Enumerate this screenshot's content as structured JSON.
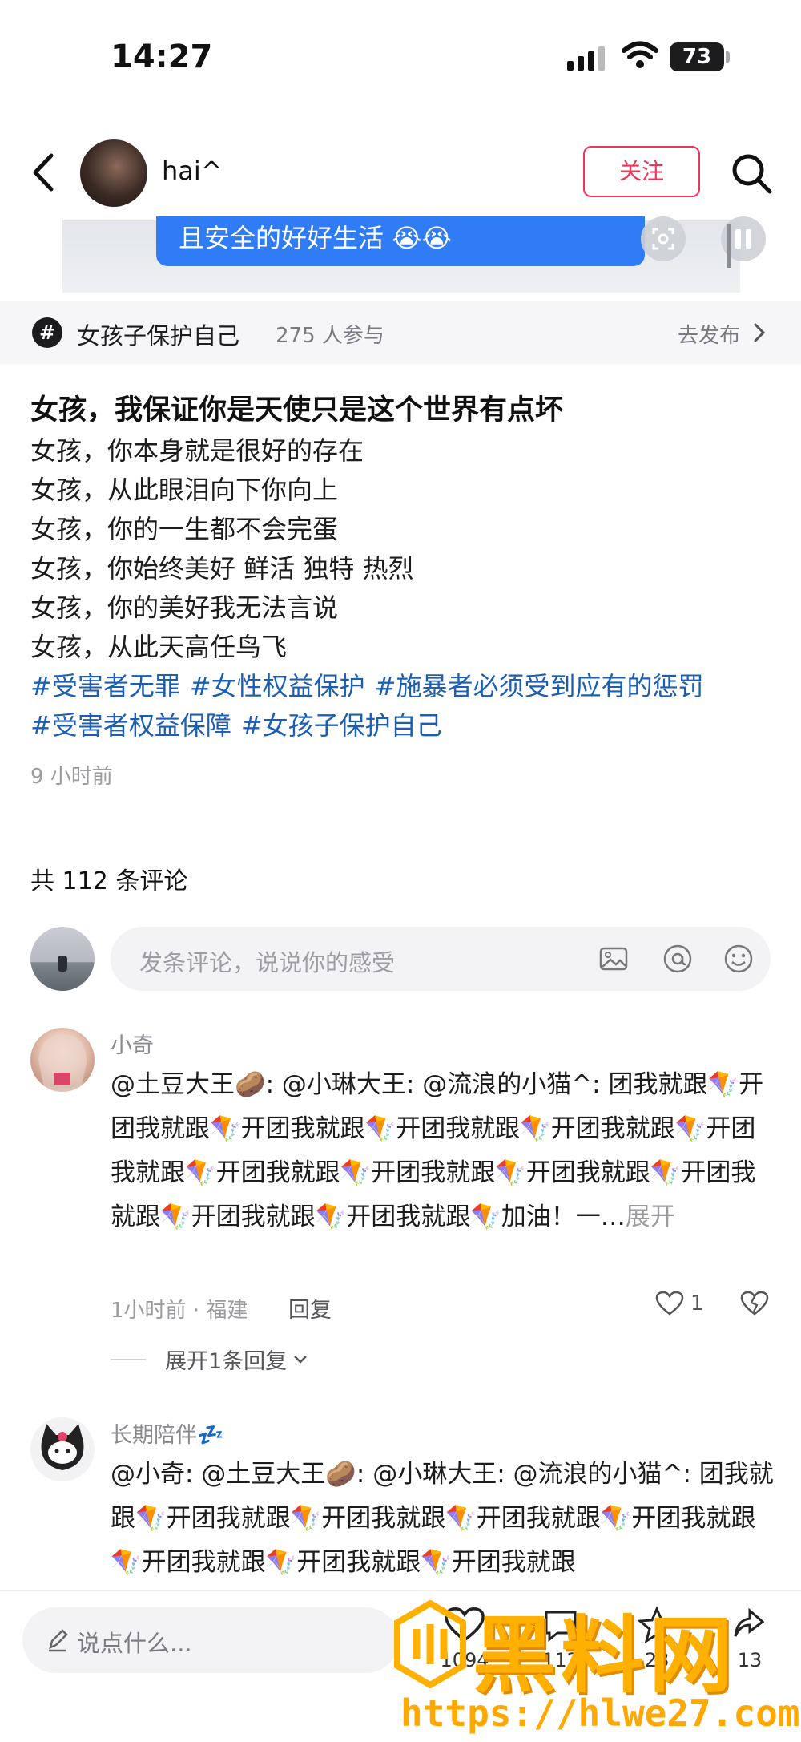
{
  "status_bar": {
    "time": "14:27",
    "battery": "73"
  },
  "header": {
    "username": "hai^",
    "follow_label": "关注"
  },
  "media": {
    "bubble_text": "且安全的好好生活 😭😭"
  },
  "topic": {
    "icon": "#",
    "name": "女孩子保护自己",
    "participants": "275 人参与",
    "action": "去发布"
  },
  "post": {
    "title": "女孩，我保证你是天使只是这个世界有点坏",
    "lines": [
      "女孩，你本身就是很好的存在",
      "女孩，从此眼泪向下你向上",
      "女孩，你的一生都不会完蛋",
      "女孩，你始终美好 鲜活 独特 热烈",
      "女孩，你的美好我无法言说",
      "女孩，从此天高任鸟飞"
    ],
    "hashtags": [
      "#受害者无罪",
      "#女性权益保护",
      "#施暴者必须受到应有的惩罚",
      "#受害者权益保障",
      "#女孩子保护自己"
    ],
    "time": "9 小时前"
  },
  "comments_header": "共 112 条评论",
  "comment_input": {
    "placeholder": "发条评论，说说你的感受"
  },
  "comments": [
    {
      "name": "小奇",
      "text": "@土豆大王🥔: @小琳大王: @流浪的小猫^: 团我就跟🪁开团我就跟🪁开团我就跟🪁开团我就跟🪁开团我就跟🪁开团我就跟🪁开团我就跟🪁开团我就跟🪁开团我就跟🪁开团我就跟🪁开团我就跟🪁开团我就跟🪁加油！一…",
      "expand": "展开",
      "meta": "1小时前 · 福建",
      "reply": "回复",
      "likes": "1",
      "expand_replies": "展开1条回复"
    },
    {
      "name": "长期陪伴💤",
      "text": "@小奇: @土豆大王🥔: @小琳大王: @流浪的小猫^: 团我就跟🪁开团我就跟🪁开团我就跟🪁开团我就跟🪁开团我就跟🪁开团我就跟🪁开团我就跟🪁开团我就跟"
    }
  ],
  "bottom_bar": {
    "placeholder": "说点什么...",
    "like_count": "1094",
    "comment_count": "112",
    "star_count": "28",
    "share_count": "13"
  },
  "watermark": {
    "text": "黑料网",
    "url": "https://hlwe27.com"
  },
  "colors": {
    "accent_red": "#f0345a",
    "hashtag_blue": "#1b5fb5",
    "bubble_blue": "#2f7cf6",
    "watermark_orange": "#ffb000"
  }
}
